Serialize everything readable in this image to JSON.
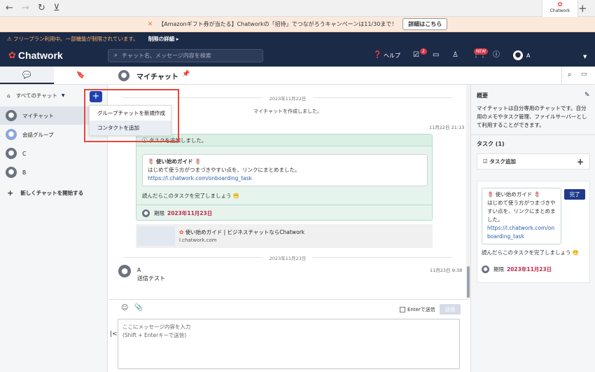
{
  "browser": {
    "tab_name": "Chatwork"
  },
  "promo": {
    "text": "【Amazonギフト券が当たる】Chatworkの「招待」でつながろうキャンペーンは11/30まで！",
    "button": "詳細はこちら"
  },
  "freeplan": {
    "warning": "⚠ フリープラン利用中。一部機能が制限されています。",
    "detail": "制限の詳細 ▸"
  },
  "header": {
    "brand": "Chatwork",
    "search_placeholder": "チャット名、メッセージ内容を検索",
    "help": "ヘルプ",
    "task_badge": "2",
    "new_badge": "NEW",
    "user_initial": "A"
  },
  "sidebar": {
    "filter_label": "すべてのチャット",
    "rooms": [
      {
        "name": "マイチャット",
        "active": true
      },
      {
        "name": "会話グループ",
        "active": false
      },
      {
        "name": "C",
        "active": false
      },
      {
        "name": "B",
        "active": false
      }
    ],
    "new_chat": "新しくチャットを開始する"
  },
  "dropdown": {
    "items": [
      "グループチャットを新規作成",
      "コンタクトを追加"
    ]
  },
  "room": {
    "title": "マイチャット"
  },
  "timeline": {
    "date1": "2023年11月22日",
    "system_msg": "マイチャットを作成しました。",
    "time1": "11月22日 21:13",
    "task_added": "タスクを追加しました。",
    "guide_title": "使い始めガイド",
    "guide_body": "はじめて使う方がつまづきやすい点を、リンクにまとめました。",
    "guide_link": "https://l.chatwork.com/onboarding_task",
    "complete_text": "読んだらこのタスクを完了しましょう",
    "due_label": "期限",
    "due_date": "2023年11月23日",
    "link_title": "使い始めガイド | ビジネスチャットならChatwork",
    "link_domain": "l.chatwork.com",
    "date2": "2023年11月23日",
    "msg2_sender": "A",
    "msg2_text": "送信テスト",
    "time2": "11月23日 9:38"
  },
  "composer": {
    "enter_send": "Enterで送信",
    "send": "送信",
    "placeholder_line1": "ここにメッセージ内容を入力",
    "placeholder_line2": "(Shift + Enterキーで送信)"
  },
  "right": {
    "overview_title": "概要",
    "overview_text": "マイチャットは自分専用のチャットです。自分用のメモやタスク管理、ファイルサーバーとして利用することができます。",
    "task_header": "タスク (1)",
    "task_add": "タスク追加",
    "done": "完了",
    "task_guide_title": "使い始めガイド",
    "task_guide_body": "はじめて使う方がつまづきやすい点を、リンクにまとめました。",
    "task_guide_link": "https://l.chatwork.com/onboarding_task",
    "task_complete": "読んだらこのタスクを完了しましょう",
    "due_label": "期限",
    "due_date": "2023年11月23日"
  }
}
